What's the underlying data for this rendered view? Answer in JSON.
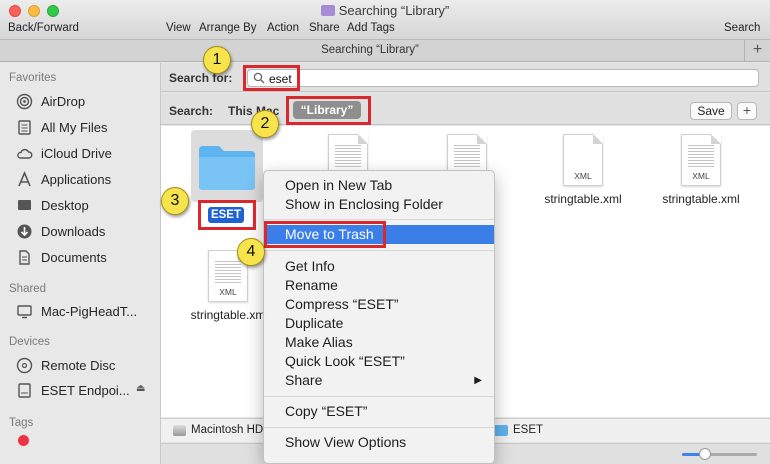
{
  "window": {
    "title": "Searching “Library”",
    "tab_title": "Searching “Library”",
    "tab_add": "+"
  },
  "toolbar": {
    "back_forward": "Back/Forward",
    "view": "View",
    "arrange_by": "Arrange By",
    "action": "Action",
    "share": "Share",
    "add_tags": "Add Tags",
    "search": "Search"
  },
  "sidebar": {
    "favorites_header": "Favorites",
    "favorites": [
      {
        "label": "AirDrop",
        "icon": "airdrop-icon"
      },
      {
        "label": "All My Files",
        "icon": "all-my-files-icon"
      },
      {
        "label": "iCloud Drive",
        "icon": "cloud-icon"
      },
      {
        "label": "Applications",
        "icon": "applications-icon"
      },
      {
        "label": "Desktop",
        "icon": "desktop-icon"
      },
      {
        "label": "Downloads",
        "icon": "downloads-icon"
      },
      {
        "label": "Documents",
        "icon": "documents-icon"
      }
    ],
    "shared_header": "Shared",
    "shared": [
      {
        "label": "Mac-PigHeadT...",
        "icon": "monitor-icon"
      }
    ],
    "devices_header": "Devices",
    "devices": [
      {
        "label": "Remote Disc",
        "icon": "disc-icon"
      },
      {
        "label": "ESET Endpoi...",
        "icon": "drive-icon"
      }
    ],
    "tags_header": "Tags"
  },
  "search": {
    "label": "Search for:",
    "value": "eset",
    "scope_label": "Search:",
    "scope_this_mac": "This Mac",
    "scope_library": "“Library”",
    "save": "Save",
    "add": "+"
  },
  "files": {
    "eset_folder": "ESET",
    "items": [
      {
        "label": "stringtable.xml",
        "badge": "XML"
      },
      {
        "label": "stringtable.xml",
        "badge": "XML"
      },
      {
        "label": "stringtable.xm",
        "badge": "XML"
      }
    ]
  },
  "pathbar": {
    "disk": "Macintosh HD",
    "folder": "ESET"
  },
  "slider": {
    "value": 0.3
  },
  "context_menu": {
    "open_new_tab": "Open in New Tab",
    "show_enclosing": "Show in Enclosing Folder",
    "move_to_trash": "Move to Trash",
    "get_info": "Get Info",
    "rename": "Rename",
    "compress": "Compress “ESET”",
    "duplicate": "Duplicate",
    "make_alias": "Make Alias",
    "quick_look": "Quick Look “ESET”",
    "share": "Share",
    "copy": "Copy “ESET”",
    "show_view_options": "Show View Options"
  },
  "annotations": {
    "step1": "1",
    "step2": "2",
    "step3": "3",
    "step4": "4",
    "highlight_color": "#d9272e",
    "badge_color": "#f7e34b"
  }
}
